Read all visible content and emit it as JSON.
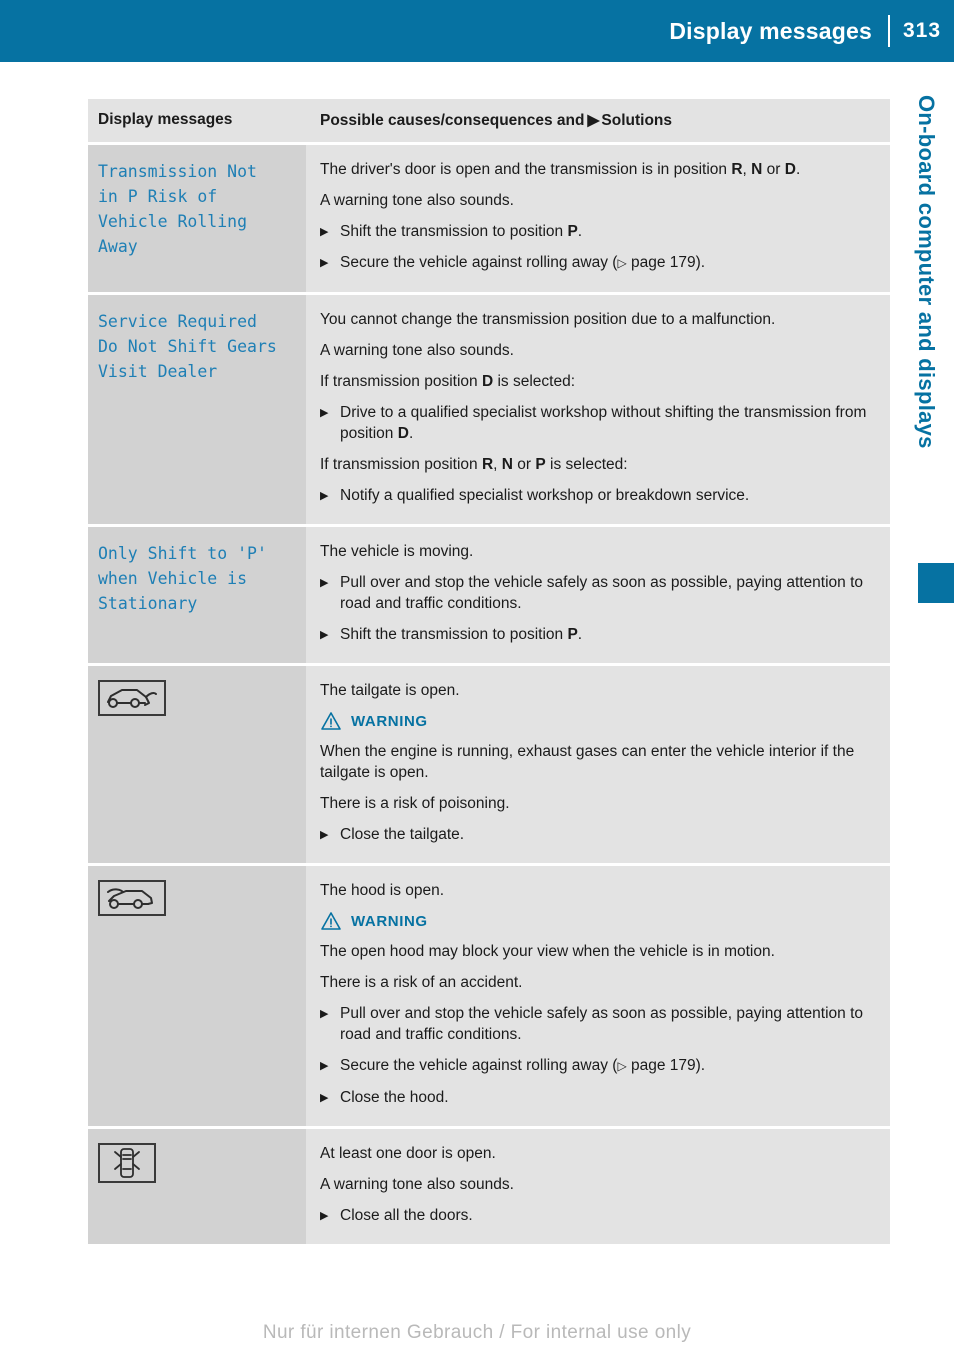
{
  "header": {
    "title": "Display messages",
    "page_number": "313"
  },
  "side_tab": {
    "label": "On-board computer and displays"
  },
  "table": {
    "headers": {
      "left": "Display messages",
      "right_before": "Possible causes/consequences and",
      "right_after": "Solutions"
    },
    "rows": [
      {
        "message": "Transmission Not\nin P Risk of\nVehicle Rolling\nAway",
        "icon": null,
        "blocks": [
          {
            "kind": "p",
            "html": "The driver's door is open and the transmission is in position <b>R</b>, <b>N</b> or <b>D</b>."
          },
          {
            "kind": "p",
            "html": "A warning tone also sounds."
          },
          {
            "kind": "bullet",
            "html": "Shift the transmission to position <b>P</b>."
          },
          {
            "kind": "bullet",
            "html": "Secure the vehicle against rolling away (<span class=\"pageref\"><span class=\"open-tri\">▷</span> page 179)</span>."
          }
        ]
      },
      {
        "message": "Service Required\nDo Not Shift Gears\nVisit Dealer",
        "icon": null,
        "blocks": [
          {
            "kind": "p",
            "html": "You cannot change the transmission position due to a malfunction."
          },
          {
            "kind": "p",
            "html": "A warning tone also sounds."
          },
          {
            "kind": "p",
            "html": "If transmission position <b>D</b> is selected:"
          },
          {
            "kind": "bullet",
            "html": "Drive to a qualified specialist workshop without shifting the transmission from position <b>D</b>."
          },
          {
            "kind": "p",
            "html": "If transmission position <b>R</b>, <b>N</b> or <b>P</b> is selected:"
          },
          {
            "kind": "bullet",
            "html": "Notify a qualified specialist workshop or breakdown service."
          }
        ]
      },
      {
        "message": "Only Shift to 'P'\nwhen Vehicle is\nStationary",
        "icon": null,
        "blocks": [
          {
            "kind": "p",
            "html": "The vehicle is moving."
          },
          {
            "kind": "bullet",
            "html": "Pull over and stop the vehicle safely as soon as possible, paying attention to road and traffic conditions."
          },
          {
            "kind": "bullet",
            "html": "Shift the transmission to position <b>P</b>."
          }
        ]
      },
      {
        "message": "",
        "icon": "tailgate-open-icon",
        "blocks": [
          {
            "kind": "p",
            "html": "The tailgate is open."
          },
          {
            "kind": "warning",
            "label": "WARNING"
          },
          {
            "kind": "p",
            "html": "When the engine is running, exhaust gases can enter the vehicle interior if the tailgate is open."
          },
          {
            "kind": "p",
            "html": "There is a risk of poisoning."
          },
          {
            "kind": "bullet",
            "html": "Close the tailgate."
          }
        ]
      },
      {
        "message": "",
        "icon": "hood-open-icon",
        "blocks": [
          {
            "kind": "p",
            "html": "The hood is open."
          },
          {
            "kind": "warning",
            "label": "WARNING"
          },
          {
            "kind": "p",
            "html": "The open hood may block your view when the vehicle is in motion."
          },
          {
            "kind": "p",
            "html": "There is a risk of an accident."
          },
          {
            "kind": "bullet",
            "html": "Pull over and stop the vehicle safely as soon as possible, paying attention to road and traffic conditions."
          },
          {
            "kind": "bullet",
            "html": "Secure the vehicle against rolling away (<span class=\"pageref\"><span class=\"open-tri\">▷</span> page 179)</span>."
          },
          {
            "kind": "bullet",
            "html": "Close the hood."
          }
        ]
      },
      {
        "message": "",
        "icon": "door-open-icon",
        "blocks": [
          {
            "kind": "p",
            "html": "At least one door is open."
          },
          {
            "kind": "p",
            "html": "A warning tone also sounds."
          },
          {
            "kind": "bullet",
            "html": "Close all the doors."
          }
        ]
      }
    ]
  },
  "footer": {
    "text": "Nur für internen Gebrauch / For internal use only"
  },
  "colors": {
    "brand_blue": "#0672A2",
    "message_blue": "#1E7FB5",
    "left_cell_bg": "#D2D2D2",
    "right_cell_bg": "#E3E3E3"
  }
}
